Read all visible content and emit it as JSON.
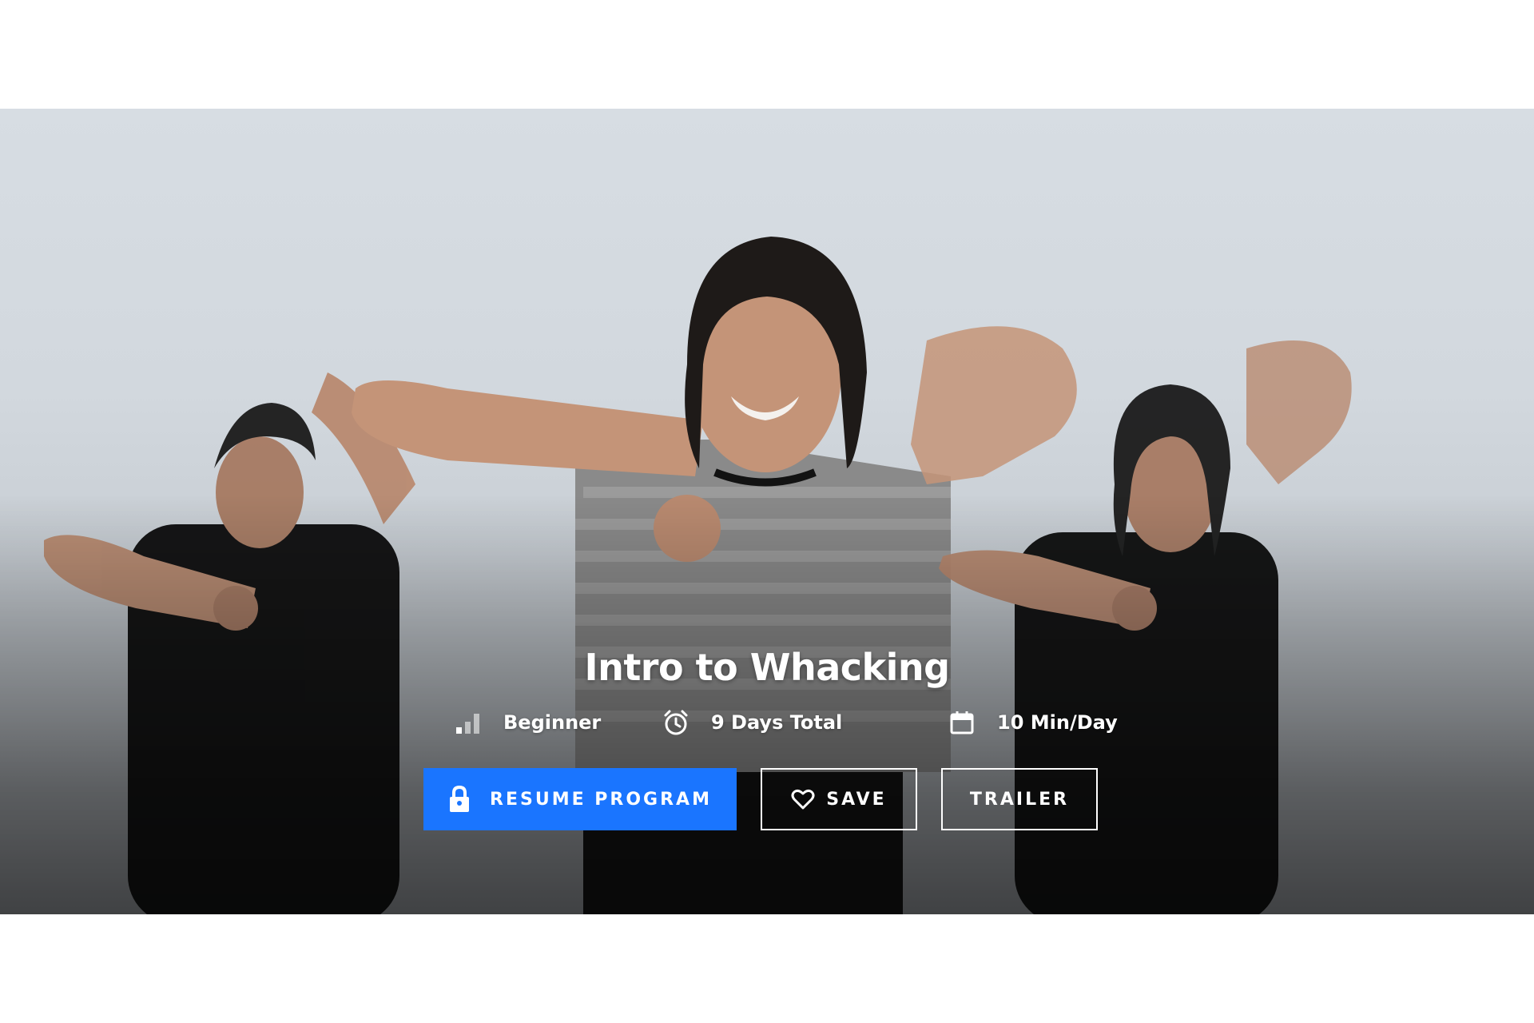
{
  "hero": {
    "title": "Intro to Whacking",
    "image_alt": "three dancers performing whacking moves"
  },
  "meta": {
    "level": {
      "icon": "signal-bars-icon",
      "label": "Beginner"
    },
    "duration": {
      "icon": "alarm-clock-icon",
      "label": "9 Days Total"
    },
    "daily": {
      "icon": "calendar-icon",
      "label": "10 Min/Day"
    }
  },
  "actions": {
    "resume": {
      "icon": "lock-icon",
      "label": "RESUME PROGRAM"
    },
    "save": {
      "icon": "heart-icon",
      "label": "SAVE"
    },
    "trailer": {
      "label": "TRAILER"
    }
  },
  "colors": {
    "primary": "#1a75ff",
    "text": "#ffffff",
    "background": "#ffffff"
  }
}
